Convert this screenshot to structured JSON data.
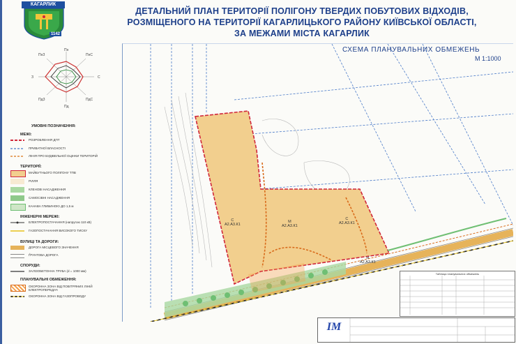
{
  "header": {
    "line1": "ДЕТАЛЬНИЙ ПЛАН ТЕРИТОРІЇ ПОЛІГОНУ ТВЕРДИХ ПОБУТОВИХ ВІДХОДІВ,",
    "line2": "РОЗМІЩЕНОГО НА ТЕРИТОРІЇ КАГАРЛИЦЬКОГО РАЙОНУ КИЇВСЬКОЇ ОБЛАСТІ,",
    "line3": "ЗА МЕЖАМИ МІСТА КАГАРЛИК"
  },
  "emblem": {
    "name": "КАГАРЛИК",
    "year": "1142"
  },
  "scheme": {
    "title": "СХЕМА ПЛАНУВАЛЬНИХ ОБМЕЖЕНЬ",
    "scale": "М 1:1000"
  },
  "windrose": {
    "labels": [
      "Пн",
      "ПнС",
      "С",
      "ПдС",
      "Пд",
      "ПдЗ",
      "З",
      "ПнЗ"
    ]
  },
  "legend": {
    "title": "УМОВНІ ПОЗНАЧЕННЯ:",
    "sections": {
      "boundaries": "МЕЖІ:",
      "territories": "ТЕРИТОРІЇ:",
      "engineering": "ІНЖЕНЕРНІ МЕРЕЖІ:",
      "streets": "ВУЛИЦІ ТА ДОРОГИ:",
      "structures": "СПОРУДИ:",
      "restrictions": "ПЛАНУВАЛЬНІ ОБМЕЖЕННЯ:"
    },
    "items": {
      "dpt": "РОЗРОБЛЕННЯ ДПТ",
      "ownership": "ПРИВАТНОЇ ВЛАСНОСТІ",
      "building_line": "ЛІНІЯ ПРО БУДІВЕЛЬНОЇ ОЦІНКИ ТЕРИТОРІЙ",
      "landfill": "МАЙБУТНЬОГО ПОЛІГОНУ ТПВ",
      "fields": "РІЛЛЯ",
      "maple": "КЛЕНОВІ НАСАДЖЕННЯ",
      "selfseed": "САМОСІВНІ НАСАДЖЕННЯ",
      "ditch": "КАНАВА ГЛИБИНОЮ ДО 1,5 м",
      "power": "ЕЛЕКТРОПОСТАЧАННЯ (напругою 110 кВ)",
      "gas": "ГАЗОПОСТАЧАННЯ ВИСОКОГО ТИСКУ",
      "local_road": "ДОРОГА МІСЦЕВОГО ЗНАЧЕННЯ",
      "dirt_road": "ҐРУНТОВА ДОРОГА",
      "culvert": "ЗАЛІЗОБЕТОННА ТРУБА (d = 1000 мм)",
      "power_zone": "ОХОРОННА ЗОНА ВІД ПОВІТРЯНИХ ЛІНІЙ ЕЛЕКТРОПЕРЕДАЧ",
      "gas_zone": "ОХОРОННА ЗОНА ВІД ГАЗОПРОВОДУ"
    }
  },
  "map": {
    "zones": [
      {
        "letter": "С",
        "code": "А2.А3.К1"
      },
      {
        "letter": "М",
        "code": "А2.А3.К1"
      },
      {
        "letter": "С",
        "code": "А2.А3.К1"
      },
      {
        "letter": "Н",
        "code": "А2.А3.К1"
      }
    ]
  },
  "stamp": {
    "logo": "ІМ",
    "caption": "Таблиця планувальних обмежень"
  },
  "colors": {
    "title": "#1d3f8a",
    "boundary": "#d0263a",
    "landfill": "#f2cf8e",
    "green": "#6fbf73",
    "road": "#e6b35a"
  }
}
